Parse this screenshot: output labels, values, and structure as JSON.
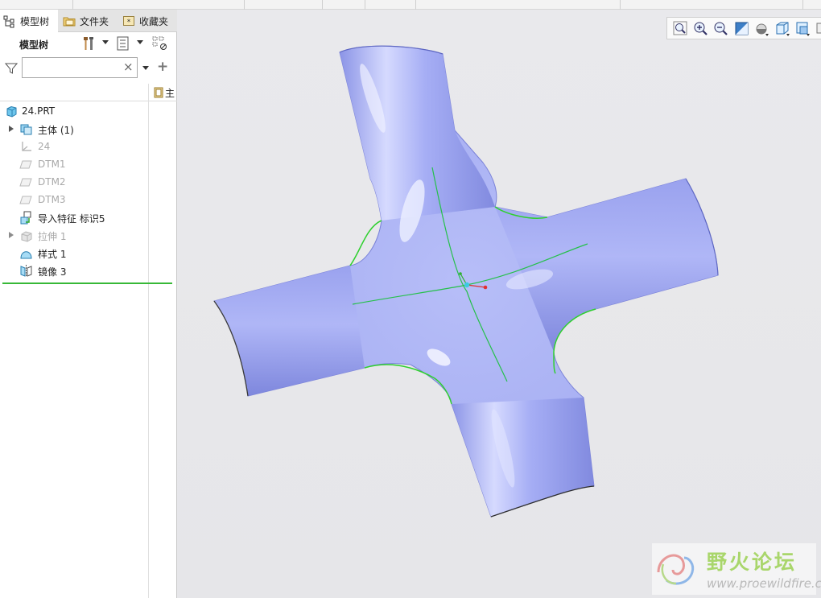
{
  "tabs": [
    {
      "label": "模型树"
    },
    {
      "label": "文件夹"
    },
    {
      "label": "收藏夹"
    }
  ],
  "tree_toolbar": {
    "title": "模型树"
  },
  "filter": {
    "value": "",
    "placeholder": "",
    "clear_glyph": "×",
    "add_glyph": "+"
  },
  "columns": {
    "second": "主"
  },
  "tree": {
    "root": {
      "label": "24.PRT",
      "icon": "part-icon"
    },
    "items": [
      {
        "label": "主体 (1)",
        "icon": "body-icon",
        "expandable": true,
        "dimmed": false
      },
      {
        "label": "24",
        "icon": "csys-icon",
        "expandable": false,
        "dimmed": true
      },
      {
        "label": "DTM1",
        "icon": "datum-plane-icon",
        "expandable": false,
        "dimmed": true
      },
      {
        "label": "DTM2",
        "icon": "datum-plane-icon",
        "expandable": false,
        "dimmed": true
      },
      {
        "label": "DTM3",
        "icon": "datum-plane-icon",
        "expandable": false,
        "dimmed": true
      },
      {
        "label": "导入特征 标识5",
        "icon": "import-feature-icon",
        "expandable": false,
        "dimmed": false
      },
      {
        "label": "拉伸 1",
        "icon": "extrude-icon",
        "expandable": true,
        "dimmed": true
      },
      {
        "label": "样式 1",
        "icon": "style-icon",
        "expandable": false,
        "dimmed": false
      },
      {
        "label": "镜像 3",
        "icon": "mirror-icon",
        "expandable": false,
        "dimmed": false
      }
    ]
  },
  "view_toolbar": {
    "buttons": [
      "refit-icon",
      "zoom-in-icon",
      "zoom-out-icon",
      "repaint-icon",
      "display-style-icon",
      "saved-views-icon",
      "view-manager-icon"
    ]
  },
  "colors": {
    "model_fill": "#a7aff2",
    "model_shadow": "#6f78c9",
    "edge_green": "#2fd02f",
    "viewport_bg": "#e8e8eb",
    "accent_green": "#37b837"
  },
  "watermark": {
    "title": "野火论坛",
    "url": "www.proewildfire.cn"
  }
}
